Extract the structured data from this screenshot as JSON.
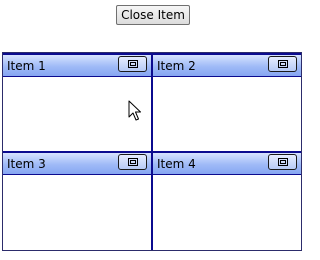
{
  "toolbar": {
    "close_label": "Close Item"
  },
  "panels": [
    {
      "title": "Item 1"
    },
    {
      "title": "Item 2"
    },
    {
      "title": "Item 3"
    },
    {
      "title": "Item 4"
    }
  ],
  "colors": {
    "header_top": "#d7e3ff",
    "header_bottom": "#86a6f2",
    "border": "#0b0b8f"
  }
}
